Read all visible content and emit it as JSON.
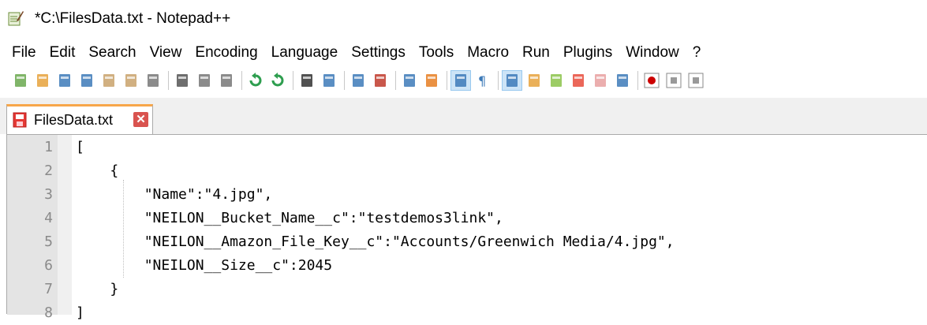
{
  "window": {
    "title": "*C:\\FilesData.txt - Notepad++",
    "app_icon": "notepad-plus-plus-icon"
  },
  "menu": {
    "items": [
      "File",
      "Edit",
      "Search",
      "View",
      "Encoding",
      "Language",
      "Settings",
      "Tools",
      "Macro",
      "Run",
      "Plugins",
      "Window",
      "?"
    ]
  },
  "toolbar": {
    "buttons": [
      "new-file-icon",
      "open-file-icon",
      "save-icon",
      "save-all-icon",
      "close-icon",
      "close-all-icon",
      "print-icon",
      "cut-icon",
      "copy-icon",
      "paste-icon",
      "undo-icon",
      "redo-icon",
      "find-icon",
      "replace-icon",
      "zoom-in-icon",
      "zoom-out-icon",
      "sync-vertical-icon",
      "sync-horizontal-icon",
      "word-wrap-icon",
      "show-all-chars-icon",
      "indent-guide-icon",
      "user-language-icon",
      "document-map-icon",
      "function-list-icon",
      "folder-workspace-icon",
      "monitoring-icon",
      "record-macro-icon",
      "stop-record-icon",
      "playback-icon"
    ]
  },
  "tabs": [
    {
      "label": "FilesData.txt",
      "icon": "unsaved-file-icon",
      "close_icon": "tab-close-icon"
    }
  ],
  "editor": {
    "lines": [
      {
        "num": "1",
        "text": "["
      },
      {
        "num": "2",
        "text": "    {"
      },
      {
        "num": "3",
        "text": "        \"Name\":\"4.jpg\","
      },
      {
        "num": "4",
        "text": "        \"NEILON__Bucket_Name__c\":\"testdemos3link\","
      },
      {
        "num": "5",
        "text": "        \"NEILON__Amazon_File_Key__c\":\"Accounts/Greenwich Media/4.jpg\","
      },
      {
        "num": "6",
        "text": "        \"NEILON__Size__c\":2045"
      },
      {
        "num": "7",
        "text": "    }"
      },
      {
        "num": "8",
        "text": "]"
      }
    ]
  },
  "colors": {
    "tab_accent": "#f7a64a",
    "close_button": "#d9534f",
    "gutter": "#e4e4e4",
    "line_number": "#8a8a8a"
  }
}
